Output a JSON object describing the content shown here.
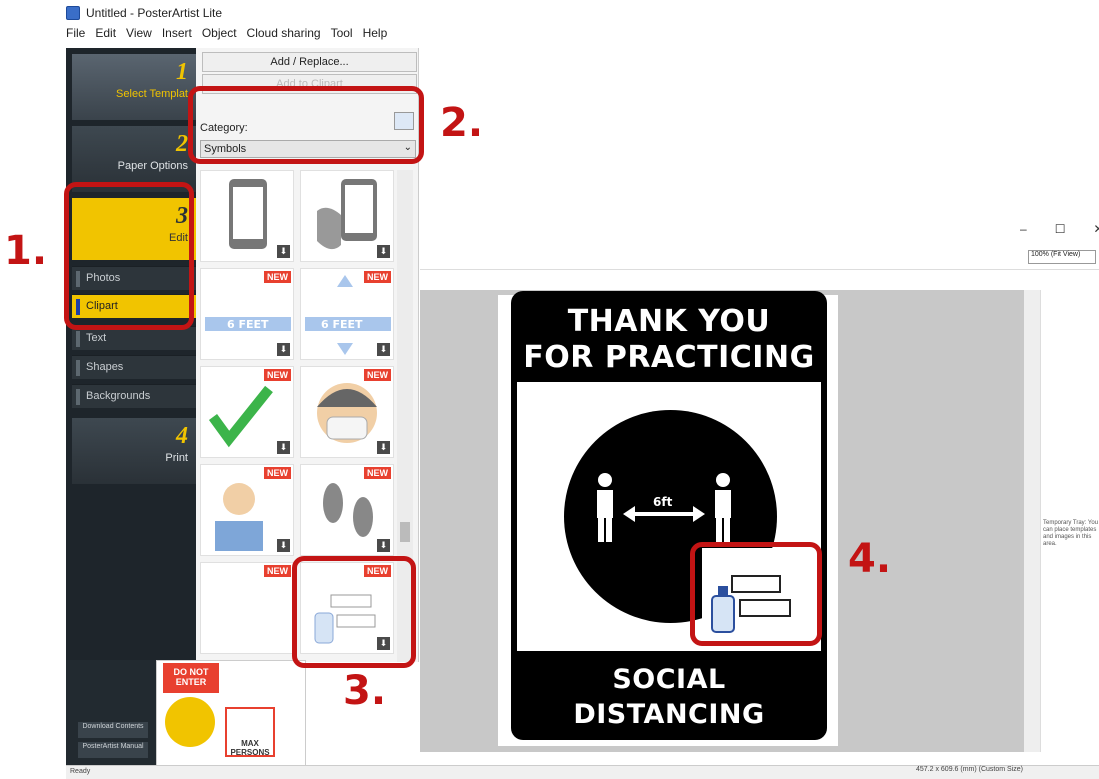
{
  "window": {
    "title": "Untitled - PosterArtist Lite"
  },
  "menu": [
    "File",
    "Edit",
    "View",
    "Insert",
    "Object",
    "Cloud sharing",
    "Tool",
    "Help"
  ],
  "steps": [
    {
      "num": "1",
      "label": "Select Templat"
    },
    {
      "num": "2",
      "label": "Paper Options"
    },
    {
      "num": "3",
      "label": "Edit"
    },
    {
      "num": "4",
      "label": "Print"
    }
  ],
  "edit_items": [
    "Photos",
    "Clipart",
    "Text",
    "Shapes",
    "Backgrounds"
  ],
  "pane": {
    "add_replace": "Add / Replace...",
    "add_to_clipart": "Add to Clipart",
    "category_label": "Category:",
    "category_value": "Symbols"
  },
  "tiles": {
    "new_badge": "NEW",
    "feet_label": "6 FEET"
  },
  "lower": {
    "download": "Download Contents",
    "manual": "PosterArtist Manual",
    "do_not_enter": "DO NOT ENTER",
    "max_persons": "MAX PERSONS"
  },
  "zoom": "100% (Fit View)",
  "tray": "Temporary Tray: You can place templates and images in this area.",
  "status": {
    "left": "Ready",
    "size": "457.2 x 609.6 (mm) (Custom Size)"
  },
  "poster": {
    "line1": "THANK YOU",
    "line2": "FOR PRACTICING",
    "distance": "6ft",
    "bottom1": "SOCIAL",
    "bottom2": "DISTANCING"
  },
  "annotations": [
    "1.",
    "2.",
    "3.",
    "4."
  ],
  "colors": {
    "accent_yellow": "#f1c400",
    "annotation_red": "#c31414"
  }
}
